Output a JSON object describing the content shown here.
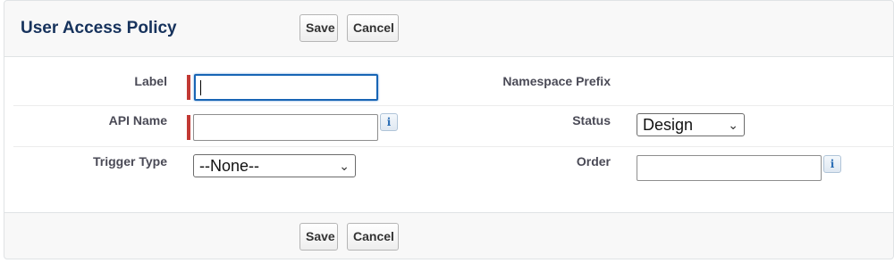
{
  "header": {
    "title": "User Access Policy",
    "save_label": "Save",
    "cancel_label": "Cancel"
  },
  "form": {
    "label": {
      "label": "Label",
      "value": ""
    },
    "namespace_prefix": {
      "label": "Namespace Prefix"
    },
    "api_name": {
      "label": "API Name",
      "value": ""
    },
    "status": {
      "label": "Status",
      "selected": "Design"
    },
    "trigger_type": {
      "label": "Trigger Type",
      "selected": "--None--"
    },
    "order": {
      "label": "Order",
      "value": ""
    },
    "info_icon_glyph": "i"
  },
  "footer": {
    "save_label": "Save",
    "cancel_label": "Cancel"
  },
  "colors": {
    "title": "#16325c",
    "required_bar": "#c23934",
    "focus_border": "#1865b5"
  }
}
